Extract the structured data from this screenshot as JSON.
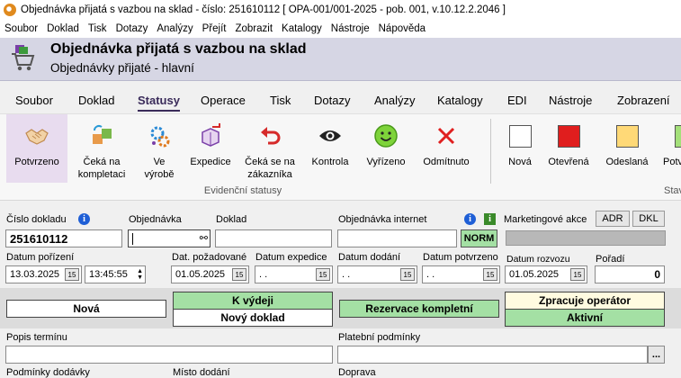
{
  "window": {
    "title": "Objednávka přijatá s vazbou na sklad - číslo: 251610112  [ OPA-001/001-2025 - pob. 001, v.10.12.2.2046 ]"
  },
  "menu": [
    "Soubor",
    "Doklad",
    "Tisk",
    "Dotazy",
    "Analýzy",
    "Přejít",
    "Zobrazit",
    "Katalogy",
    "Nástroje",
    "Nápověda"
  ],
  "header": {
    "title": "Objednávka přijatá s vazbou na sklad",
    "subtitle": "Objednávky přijaté - hlavní"
  },
  "ribbon_tabs": [
    "Soubor",
    "Doklad",
    "Statusy",
    "Operace",
    "Tisk",
    "Dotazy",
    "Analýzy",
    "Katalogy",
    "EDI",
    "Nástroje",
    "Zobrazení"
  ],
  "ribbon_active": "Statusy",
  "ribbon": {
    "group1_caption": "Evidenční statusy",
    "group2_caption": "Stav",
    "buttons": [
      {
        "label": "Potvrzeno",
        "icon": "handshake-icon"
      },
      {
        "label": "Čeká na kompletaci",
        "icon": "boxes-icon"
      },
      {
        "label": "Ve výrobě",
        "icon": "gears-icon"
      },
      {
        "label": "Expedice",
        "icon": "box-arrow-icon"
      },
      {
        "label": "Čeká se na zákazníka",
        "icon": "undo-arrow-icon"
      },
      {
        "label": "Kontrola",
        "icon": "eye-icon"
      },
      {
        "label": "Vyřízeno",
        "icon": "smiley-icon"
      },
      {
        "label": "Odmítnuto",
        "icon": "x-icon"
      },
      {
        "label": "Nová",
        "icon": "white-square-icon"
      },
      {
        "label": "Otevřená",
        "icon": "red-square-icon"
      },
      {
        "label": "Odeslaná",
        "icon": "yellow-square-icon"
      },
      {
        "label": "Potv",
        "icon": "green-square-icon"
      }
    ]
  },
  "form": {
    "cislo_dokladu_label": "Číslo dokladu",
    "cislo_dokladu": "251610112",
    "objednavka_label": "Objednávka",
    "objednavka": "",
    "doklad_label": "Doklad",
    "doklad": "",
    "obj_internet_label": "Objednávka internet",
    "obj_internet": "",
    "norm": "NORM",
    "marketing_label": "Marketingové akce",
    "adr": "ADR",
    "dkl": "DKL",
    "datum_porizeni_label": "Datum pořízení",
    "datum_porizeni": "13.03.2025",
    "cas_porizeni": "13:45:55",
    "dat_pozadovane_label": "Dat. požadované",
    "dat_pozadovane": "01.05.2025",
    "datum_expedice_label": "Datum expedice",
    "datum_expedice": " .  .",
    "datum_dodani_label": "Datum dodání",
    "datum_dodani": " .  .",
    "datum_potvrzeno_label": "Datum potvrzeno",
    "datum_potvrzeno": " .  .",
    "datum_rozvozu_label": "Datum rozvozu",
    "datum_rozvozu": "01.05.2025",
    "poradi_label": "Pořadí",
    "poradi": "0",
    "status_nova": "Nová",
    "status_k_vydeji": "K výdeji",
    "status_novy_doklad": "Nový doklad",
    "status_rezervace": "Rezervace kompletní",
    "status_zpracuje": "Zpracuje operátor",
    "status_aktivni": "Aktivní",
    "popis_terminu_label": "Popis termínu",
    "popis_terminu": "",
    "platebni_label": "Platební podmínky",
    "platebni": "",
    "ellipsis": "...",
    "podminky_dodavky_label": "Podmínky dodávky",
    "misto_dodani_label": "Místo dodání",
    "doprava_label": "Doprava"
  },
  "colors": {
    "status_green": "#a4e0a4",
    "status_yellow": "#fffbe0",
    "header_bg": "#d6d6e4",
    "selected_ribbon": "#e8dcef"
  }
}
